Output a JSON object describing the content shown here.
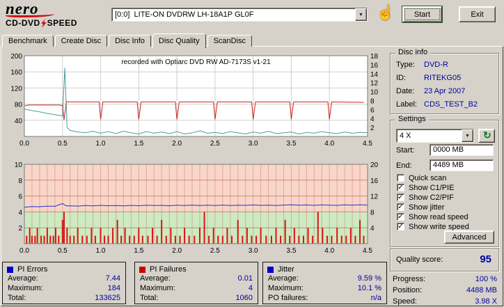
{
  "toolbar": {
    "logo_line1": "nero",
    "logo_line2_left": "CD-DVD",
    "logo_line2_right": "SPEED",
    "drive_selector": "[0:0]  LITE-ON DVDRW LH-18A1P GL0F",
    "start_label": "Start",
    "exit_label": "Exit"
  },
  "icons": {
    "hand": "☝",
    "refresh": "↻",
    "dropdown_arrow": "▼",
    "checkmark": "✓"
  },
  "tabs": [
    {
      "label": "Benchmark",
      "active": false
    },
    {
      "label": "Create Disc",
      "active": false
    },
    {
      "label": "Disc Info",
      "active": false
    },
    {
      "label": "Disc Quality",
      "active": true
    },
    {
      "label": "ScanDisc",
      "active": false
    }
  ],
  "disc_info": {
    "legend": "Disc info",
    "rows": [
      [
        "Type:",
        "DVD-R"
      ],
      [
        "ID:",
        "RITEKG05"
      ],
      [
        "Date:",
        "23 Apr 2007"
      ],
      [
        "Label:",
        "CDS_TEST_B2"
      ]
    ]
  },
  "settings": {
    "legend": "Settings",
    "speed_selected": "4 X",
    "start_label": "Start:",
    "start_value": "0000 MB",
    "end_label": "End:",
    "end_value": "4489 MB",
    "checkboxes": [
      {
        "label": "Quick scan",
        "checked": false
      },
      {
        "label": "Show C1/PIE",
        "checked": true
      },
      {
        "label": "Show C2/PIF",
        "checked": true
      },
      {
        "label": "Show jitter",
        "checked": true
      },
      {
        "label": "Show read speed",
        "checked": true
      },
      {
        "label": "Show write speed",
        "checked": true
      }
    ],
    "advanced_label": "Advanced"
  },
  "quality_score": {
    "label": "Quality score:",
    "value": "95"
  },
  "status_rows": [
    [
      "Progress:",
      "100 %"
    ],
    [
      "Position:",
      "4488 MB"
    ],
    [
      "Speed:",
      "3.98 X"
    ]
  ],
  "stats_boxes": [
    {
      "title": "PI Errors",
      "marker_color": "#0000cc",
      "rows": [
        [
          "Average:",
          "7.44"
        ],
        [
          "Maximum:",
          "184"
        ],
        [
          "Total:",
          "133625"
        ]
      ]
    },
    {
      "title": "PI Failures",
      "marker_color": "#cc0000",
      "rows": [
        [
          "Average:",
          "0.01"
        ],
        [
          "Maximum:",
          "4"
        ],
        [
          "Total:",
          "1060"
        ]
      ]
    },
    {
      "title": "Jitter",
      "marker_color": "#0000cc",
      "rows": [
        [
          "Average:",
          "9.59 %"
        ],
        [
          "Maximum:",
          "10.1 %"
        ],
        [
          "PO failures:",
          "n/a"
        ]
      ]
    }
  ],
  "chart_data": [
    {
      "type": "line",
      "title": "recorded with Optiarc DVD RW AD-7173S  v1-21",
      "x_range": [
        0,
        4.5
      ],
      "x_tick_step": 0.5,
      "left_axis": {
        "range": [
          0,
          200
        ],
        "tick_step": 40
      },
      "right_axis": {
        "range": [
          0,
          18
        ],
        "tick_step": 2
      },
      "grid": true,
      "series": [
        {
          "name": "C1/PIE",
          "axis": "left",
          "color": "#4e9b9b",
          "points": [
            [
              0,
              68
            ],
            [
              0.1,
              64
            ],
            [
              0.2,
              61
            ],
            [
              0.3,
              57
            ],
            [
              0.4,
              54
            ],
            [
              0.5,
              51
            ],
            [
              0.53,
              170
            ],
            [
              0.56,
              22
            ],
            [
              0.6,
              15
            ],
            [
              0.7,
              11
            ],
            [
              0.8,
              9
            ],
            [
              0.9,
              13
            ],
            [
              1,
              8
            ],
            [
              1.1,
              12
            ],
            [
              1.2,
              7
            ],
            [
              1.3,
              13
            ],
            [
              1.4,
              9
            ],
            [
              1.5,
              6
            ],
            [
              1.6,
              12
            ],
            [
              1.7,
              8
            ],
            [
              1.8,
              11
            ],
            [
              1.9,
              7
            ],
            [
              2,
              12
            ],
            [
              2.1,
              6
            ],
            [
              2.2,
              9
            ],
            [
              2.3,
              14
            ],
            [
              2.4,
              8
            ],
            [
              2.5,
              10
            ],
            [
              2.6,
              7
            ],
            [
              2.7,
              12
            ],
            [
              2.8,
              9
            ],
            [
              2.9,
              6
            ],
            [
              3,
              11
            ],
            [
              3.1,
              8
            ],
            [
              3.2,
              13
            ],
            [
              3.3,
              7
            ],
            [
              3.4,
              9
            ],
            [
              3.5,
              11
            ],
            [
              3.6,
              6
            ],
            [
              3.7,
              10
            ],
            [
              3.8,
              8
            ],
            [
              3.9,
              12
            ],
            [
              4,
              9
            ],
            [
              4.1,
              7
            ],
            [
              4.2,
              11
            ],
            [
              4.3,
              8
            ],
            [
              4.4,
              10
            ],
            [
              4.5,
              9
            ]
          ]
        },
        {
          "name": "write speed",
          "axis": "right",
          "color": "#cc2222",
          "points": [
            [
              0,
              6.8
            ],
            [
              0.05,
              7.0
            ],
            [
              0.45,
              7.0
            ],
            [
              0.5,
              6.9
            ],
            [
              0.52,
              3.7
            ],
            [
              0.55,
              7.7
            ],
            [
              0.98,
              7.7
            ],
            [
              1.0,
              3.8
            ],
            [
              1.03,
              7.7
            ],
            [
              1.48,
              7.7
            ],
            [
              1.5,
              3.8
            ],
            [
              1.53,
              7.7
            ],
            [
              1.98,
              7.7
            ],
            [
              2.0,
              3.8
            ],
            [
              2.03,
              7.7
            ],
            [
              2.48,
              7.7
            ],
            [
              2.5,
              3.8
            ],
            [
              2.53,
              7.7
            ],
            [
              2.98,
              7.7
            ],
            [
              3.0,
              3.8
            ],
            [
              3.03,
              7.7
            ],
            [
              3.48,
              7.7
            ],
            [
              3.5,
              3.8
            ],
            [
              3.53,
              7.7
            ],
            [
              3.98,
              7.7
            ],
            [
              4.0,
              3.8
            ],
            [
              4.03,
              7.7
            ],
            [
              4.45,
              7.6
            ]
          ]
        }
      ]
    },
    {
      "type": "bar+line",
      "x_range": [
        0,
        4.5
      ],
      "x_tick_step": 0.5,
      "left_axis": {
        "range": [
          0,
          10
        ],
        "tick_step": 2
      },
      "right_axis": {
        "range": [
          0,
          20
        ],
        "tick_step": 4
      },
      "zones": [
        {
          "axis": "left",
          "from": 0,
          "to": 4,
          "color": "#cdeac2"
        },
        {
          "axis": "left",
          "from": 4,
          "to": 10,
          "color": "#f8d6c9"
        }
      ],
      "series": [
        {
          "name": "C2/PIF",
          "type": "bar",
          "axis": "left",
          "color": "#dd1111",
          "points": [
            [
              0.03,
              1
            ],
            [
              0.07,
              2
            ],
            [
              0.1,
              1
            ],
            [
              0.14,
              1
            ],
            [
              0.17,
              2
            ],
            [
              0.22,
              1
            ],
            [
              0.26,
              1
            ],
            [
              0.3,
              2
            ],
            [
              0.34,
              1
            ],
            [
              0.38,
              1
            ],
            [
              0.41,
              2
            ],
            [
              0.45,
              1
            ],
            [
              0.5,
              3
            ],
            [
              0.52,
              4
            ],
            [
              0.56,
              2
            ],
            [
              0.6,
              1
            ],
            [
              0.65,
              1
            ],
            [
              0.7,
              2
            ],
            [
              0.76,
              1
            ],
            [
              0.82,
              1
            ],
            [
              0.88,
              2
            ],
            [
              0.93,
              1
            ],
            [
              1,
              2
            ],
            [
              1.05,
              1
            ],
            [
              1.1,
              1
            ],
            [
              1.16,
              2
            ],
            [
              1.22,
              3
            ],
            [
              1.27,
              1
            ],
            [
              1.32,
              2
            ],
            [
              1.38,
              1
            ],
            [
              1.44,
              1
            ],
            [
              1.5,
              2
            ],
            [
              1.55,
              1
            ],
            [
              1.62,
              1
            ],
            [
              1.68,
              2
            ],
            [
              1.74,
              1
            ],
            [
              1.8,
              3
            ],
            [
              1.86,
              1
            ],
            [
              1.92,
              2
            ],
            [
              1.98,
              1
            ],
            [
              2.04,
              1
            ],
            [
              2.1,
              2
            ],
            [
              2.16,
              1
            ],
            [
              2.23,
              1
            ],
            [
              2.3,
              2
            ],
            [
              2.36,
              4
            ],
            [
              2.42,
              1
            ],
            [
              2.48,
              2
            ],
            [
              2.54,
              1
            ],
            [
              2.6,
              1
            ],
            [
              2.66,
              2
            ],
            [
              2.72,
              1
            ],
            [
              2.8,
              3
            ],
            [
              2.86,
              1
            ],
            [
              2.92,
              2
            ],
            [
              2.98,
              1
            ],
            [
              3.04,
              1
            ],
            [
              3.1,
              2
            ],
            [
              3.17,
              1
            ],
            [
              3.24,
              1
            ],
            [
              3.3,
              2
            ],
            [
              3.36,
              1
            ],
            [
              3.42,
              3
            ],
            [
              3.48,
              1
            ],
            [
              3.54,
              2
            ],
            [
              3.6,
              1
            ],
            [
              3.66,
              1
            ],
            [
              3.72,
              2
            ],
            [
              3.78,
              1
            ],
            [
              3.85,
              4
            ],
            [
              3.91,
              2
            ],
            [
              3.97,
              1
            ],
            [
              4.03,
              1
            ],
            [
              4.1,
              2
            ],
            [
              4.16,
              1
            ],
            [
              4.22,
              1
            ],
            [
              4.28,
              2
            ],
            [
              4.34,
              1
            ],
            [
              4.4,
              3
            ],
            [
              4.45,
              1
            ]
          ]
        },
        {
          "name": "jitter",
          "type": "line",
          "axis": "right",
          "color": "#2233cc",
          "points": [
            [
              0,
              9.2
            ],
            [
              0.1,
              9.35
            ],
            [
              0.2,
              9.3
            ],
            [
              0.3,
              9.45
            ],
            [
              0.4,
              9.4
            ],
            [
              0.5,
              10.1
            ],
            [
              0.55,
              9.5
            ],
            [
              0.6,
              9.55
            ],
            [
              0.7,
              9.45
            ],
            [
              0.8,
              9.6
            ],
            [
              0.9,
              9.5
            ],
            [
              1,
              9.65
            ],
            [
              1.1,
              9.55
            ],
            [
              1.2,
              9.6
            ],
            [
              1.3,
              9.5
            ],
            [
              1.4,
              9.65
            ],
            [
              1.5,
              9.55
            ],
            [
              1.6,
              9.7
            ],
            [
              1.7,
              9.6
            ],
            [
              1.8,
              9.65
            ],
            [
              1.9,
              9.55
            ],
            [
              2,
              9.7
            ],
            [
              2.1,
              9.6
            ],
            [
              2.2,
              9.72
            ],
            [
              2.3,
              9.6
            ],
            [
              2.4,
              9.7
            ],
            [
              2.5,
              9.62
            ],
            [
              2.6,
              9.72
            ],
            [
              2.7,
              9.6
            ],
            [
              2.8,
              9.7
            ],
            [
              2.9,
              9.65
            ],
            [
              3,
              9.75
            ],
            [
              3.1,
              9.65
            ],
            [
              3.2,
              9.7
            ],
            [
              3.3,
              9.6
            ],
            [
              3.4,
              9.72
            ],
            [
              3.5,
              9.8
            ],
            [
              3.6,
              9.68
            ],
            [
              3.7,
              9.75
            ],
            [
              3.8,
              9.65
            ],
            [
              3.9,
              9.78
            ],
            [
              4,
              9.7
            ],
            [
              4.1,
              9.65
            ],
            [
              4.2,
              9.78
            ],
            [
              4.3,
              9.7
            ],
            [
              4.4,
              9.8
            ],
            [
              4.5,
              9.72
            ]
          ]
        }
      ]
    }
  ]
}
